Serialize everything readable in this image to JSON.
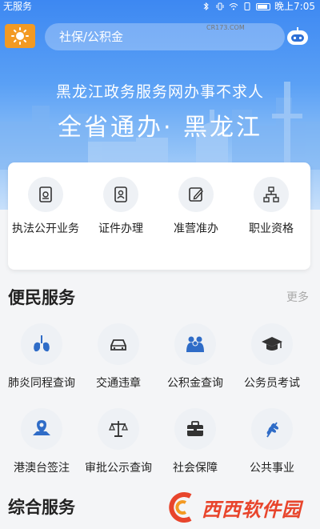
{
  "status": {
    "carrier": "无服务",
    "time": "晚上7:05"
  },
  "header": {
    "search_text": "社保/公积金",
    "slogan_line1": "黑龙江政务服务网办事不求人",
    "slogan_line2": "全省通办· 黑龙江"
  },
  "quick": [
    {
      "label": "执法公开业务",
      "icon": "document-icon"
    },
    {
      "label": "证件办理",
      "icon": "id-card-icon"
    },
    {
      "label": "准营准办",
      "icon": "edit-icon"
    },
    {
      "label": "职业资格",
      "icon": "org-chart-icon"
    }
  ],
  "convenience": {
    "title": "便民服务",
    "more": "更多",
    "items": [
      {
        "label": "肺炎同程查询",
        "icon": "lungs-icon"
      },
      {
        "label": "交通违章",
        "icon": "car-icon"
      },
      {
        "label": "公积金查询",
        "icon": "people-icon"
      },
      {
        "label": "公务员考试",
        "icon": "graduation-cap-icon"
      },
      {
        "label": "港澳台签注",
        "icon": "map-pin-icon"
      },
      {
        "label": "审批公示查询",
        "icon": "scales-icon"
      },
      {
        "label": "社会保障",
        "icon": "toolbox-icon"
      },
      {
        "label": "公共事业",
        "icon": "wheat-icon"
      }
    ]
  },
  "comprehensive": {
    "title": "综合服务"
  },
  "watermark": {
    "text": "西西软件园",
    "sub": "CR173.COM"
  },
  "colors": {
    "accent": "#2f7ce8",
    "sun_button": "#f39a23",
    "watermark": "#e8452c"
  }
}
